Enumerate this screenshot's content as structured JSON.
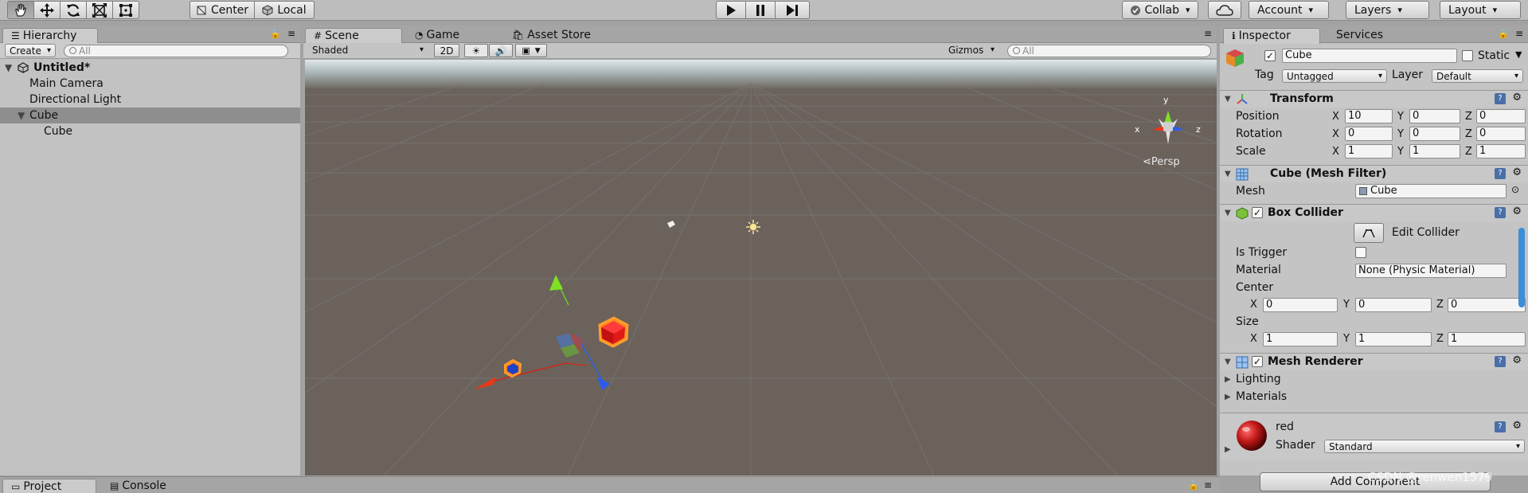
{
  "toolbar": {
    "tools": [
      "hand-tool",
      "move-tool",
      "rotate-tool",
      "scale-tool",
      "rect-tool"
    ],
    "pivot_label": "Center",
    "space_label": "Local",
    "play_controls": [
      "play",
      "pause",
      "step"
    ],
    "collab_label": "Collab",
    "account_label": "Account",
    "layers_label": "Layers",
    "layout_label": "Layout"
  },
  "hierarchy": {
    "tab_label": "Hierarchy",
    "create_label": "Create",
    "search_placeholder": "All",
    "scene_name": "Untitled*",
    "items": [
      {
        "label": "Main Camera",
        "depth": 1,
        "selected": false
      },
      {
        "label": "Directional Light",
        "depth": 1,
        "selected": false
      },
      {
        "label": "Cube",
        "depth": 1,
        "selected": true,
        "expanded": true
      },
      {
        "label": "Cube",
        "depth": 2,
        "selected": false
      }
    ]
  },
  "scene": {
    "tabs": [
      "Scene",
      "Game",
      "Asset Store"
    ],
    "active_tab": "Scene",
    "shading_mode": "Shaded",
    "mode_2d_label": "2D",
    "gizmos_label": "Gizmos",
    "search_placeholder": "All",
    "projection_label": "Persp",
    "axis_labels": {
      "x": "x",
      "y": "y",
      "z": "z"
    }
  },
  "inspector": {
    "tabs": [
      "Inspector",
      "Services"
    ],
    "object_name": "Cube",
    "active": true,
    "static_label": "Static",
    "tag_label": "Tag",
    "tag_value": "Untagged",
    "layer_label": "Layer",
    "layer_value": "Default",
    "transform": {
      "title": "Transform",
      "position_label": "Position",
      "rotation_label": "Rotation",
      "scale_label": "Scale",
      "position": {
        "x": "10",
        "y": "0",
        "z": "0"
      },
      "rotation": {
        "x": "0",
        "y": "0",
        "z": "0"
      },
      "scale": {
        "x": "1",
        "y": "1",
        "z": "1"
      }
    },
    "mesh_filter": {
      "title": "Cube (Mesh Filter)",
      "mesh_label": "Mesh",
      "mesh_value": "Cube"
    },
    "box_collider": {
      "title": "Box Collider",
      "enabled": true,
      "edit_collider_label": "Edit Collider",
      "is_trigger_label": "Is Trigger",
      "is_trigger": false,
      "material_label": "Material",
      "material_value": "None (Physic Material)",
      "center_label": "Center",
      "center": {
        "x": "0",
        "y": "0",
        "z": "0"
      },
      "size_label": "Size",
      "size": {
        "x": "1",
        "y": "1",
        "z": "1"
      }
    },
    "mesh_renderer": {
      "title": "Mesh Renderer",
      "enabled": true,
      "lighting_label": "Lighting",
      "materials_label": "Materials"
    },
    "material": {
      "name": "red",
      "shader_label": "Shader",
      "shader_value": "Standard",
      "color": "#c01818"
    },
    "add_component_label": "Add Component"
  },
  "bottom": {
    "tabs": [
      "Project",
      "Console"
    ]
  },
  "watermark": "CSDN @renwen1579",
  "axis_letters": {
    "x": "X",
    "y": "Y",
    "z": "Z"
  }
}
